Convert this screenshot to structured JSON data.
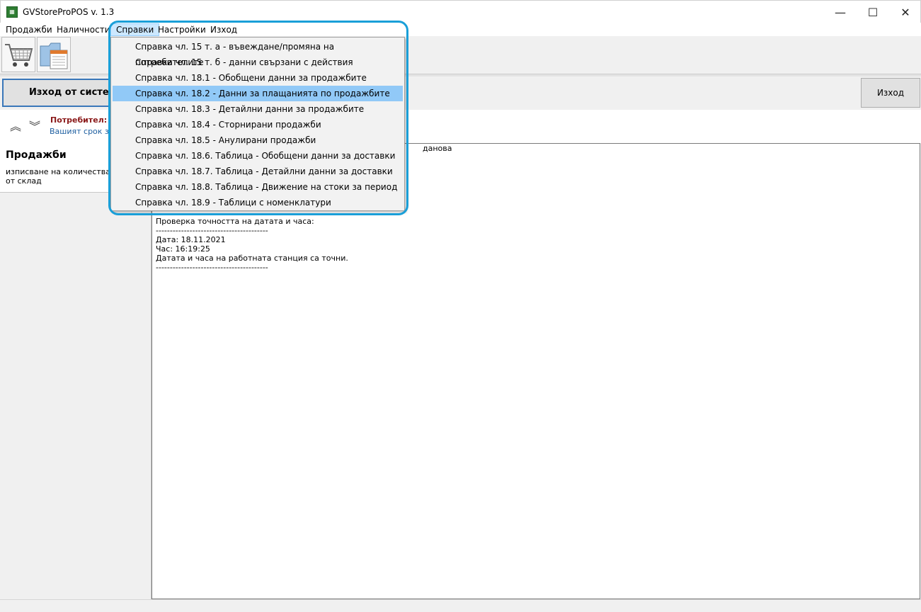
{
  "window": {
    "title": "GVStoreProPOS v. 1.3",
    "minimize": "—",
    "maximize": "☐",
    "close": "✕"
  },
  "menubar": {
    "items": [
      {
        "label": "Продажби"
      },
      {
        "label": "Наличности"
      },
      {
        "label": "Справки"
      },
      {
        "label": "Настройки"
      },
      {
        "label": "Изход"
      }
    ]
  },
  "reports_menu": {
    "items": [
      "Справка чл. 15 т. а - въвеждане/промяна на потребителите",
      "Справка чл. 15 т. б - данни свързани с действия",
      "Справка чл. 18.1 - Обобщени данни за продажбите",
      "Справка чл. 18.2 - Данни за плащанията по продажбите",
      "Справка чл. 18.3 - Детайлни данни за продажбите",
      "Справка чл. 18.4 - Сторнирани продажби",
      "Справка чл. 18.5 - Анулирани продажби",
      "Справка чл. 18.6. Таблица - Обобщени данни за доставки",
      "Справка чл. 18.7. Таблица - Детайлни данни за доставки",
      "Справка чл. 18.8. Таблица - Движение на стоки за период",
      "Справка чл. 18.9 - Таблици с номенклатури"
    ],
    "highlighted_index": 3
  },
  "action_bar": {
    "logout_label": "Изход от система",
    "exit_label": "Изход"
  },
  "user_bar": {
    "user_label": "Потребител: М",
    "subscription_text": "Вашият срок за"
  },
  "sales_card": {
    "title": "Продажби",
    "description": "изписване на количества от склад"
  },
  "log": {
    "fragment_top": "данова",
    "lines": [
      "Проверка точността на датата и часа:",
      "----------------------------------------",
      "Дата: 18.11.2021",
      "Час: 16:19:25",
      "Датата и часа на работната станция са точни.",
      "----------------------------------------"
    ]
  },
  "colors": {
    "menu_highlight": "#91c9f7",
    "focus_ring": "#1a9fd8",
    "user_label": "#8b1a1a",
    "link_blue": "#1e5fa0"
  }
}
